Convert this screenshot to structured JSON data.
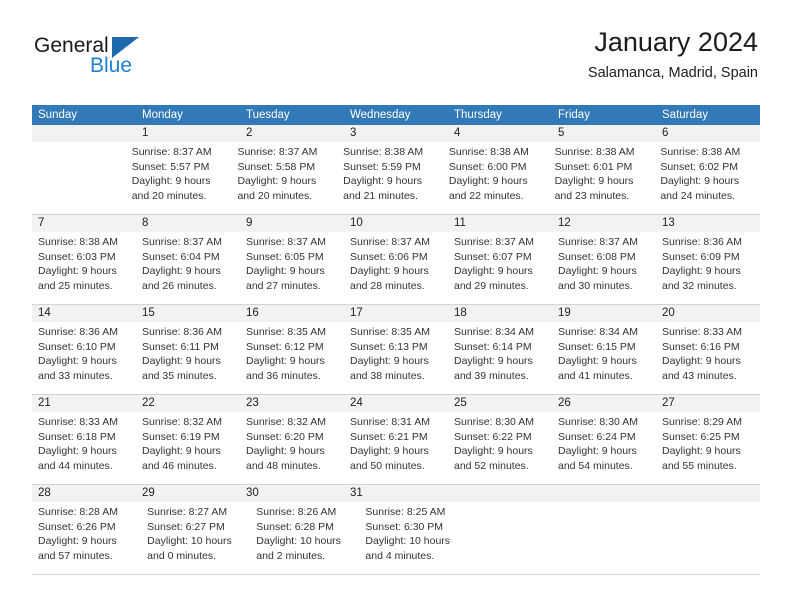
{
  "brand": {
    "name_part1": "General",
    "name_part2": "Blue",
    "logo_icon": "triangle-icon",
    "accent_color": "#1f7fd0",
    "triangle_color": "#1e68ad"
  },
  "header": {
    "month_title": "January 2024",
    "location": "Salamanca, Madrid, Spain",
    "header_bg_color": "#3279b7",
    "datebar_bg_color": "#f2f2f2"
  },
  "weekdays": [
    "Sunday",
    "Monday",
    "Tuesday",
    "Wednesday",
    "Thursday",
    "Friday",
    "Saturday"
  ],
  "weeks": [
    {
      "days": [
        {
          "num": "",
          "empty": true
        },
        {
          "num": "1",
          "sunrise": "Sunrise: 8:37 AM",
          "sunset": "Sunset: 5:57 PM",
          "daylight": "Daylight: 9 hours and 20 minutes."
        },
        {
          "num": "2",
          "sunrise": "Sunrise: 8:37 AM",
          "sunset": "Sunset: 5:58 PM",
          "daylight": "Daylight: 9 hours and 20 minutes."
        },
        {
          "num": "3",
          "sunrise": "Sunrise: 8:38 AM",
          "sunset": "Sunset: 5:59 PM",
          "daylight": "Daylight: 9 hours and 21 minutes."
        },
        {
          "num": "4",
          "sunrise": "Sunrise: 8:38 AM",
          "sunset": "Sunset: 6:00 PM",
          "daylight": "Daylight: 9 hours and 22 minutes."
        },
        {
          "num": "5",
          "sunrise": "Sunrise: 8:38 AM",
          "sunset": "Sunset: 6:01 PM",
          "daylight": "Daylight: 9 hours and 23 minutes."
        },
        {
          "num": "6",
          "sunrise": "Sunrise: 8:38 AM",
          "sunset": "Sunset: 6:02 PM",
          "daylight": "Daylight: 9 hours and 24 minutes."
        }
      ]
    },
    {
      "days": [
        {
          "num": "7",
          "sunrise": "Sunrise: 8:38 AM",
          "sunset": "Sunset: 6:03 PM",
          "daylight": "Daylight: 9 hours and 25 minutes."
        },
        {
          "num": "8",
          "sunrise": "Sunrise: 8:37 AM",
          "sunset": "Sunset: 6:04 PM",
          "daylight": "Daylight: 9 hours and 26 minutes."
        },
        {
          "num": "9",
          "sunrise": "Sunrise: 8:37 AM",
          "sunset": "Sunset: 6:05 PM",
          "daylight": "Daylight: 9 hours and 27 minutes."
        },
        {
          "num": "10",
          "sunrise": "Sunrise: 8:37 AM",
          "sunset": "Sunset: 6:06 PM",
          "daylight": "Daylight: 9 hours and 28 minutes."
        },
        {
          "num": "11",
          "sunrise": "Sunrise: 8:37 AM",
          "sunset": "Sunset: 6:07 PM",
          "daylight": "Daylight: 9 hours and 29 minutes."
        },
        {
          "num": "12",
          "sunrise": "Sunrise: 8:37 AM",
          "sunset": "Sunset: 6:08 PM",
          "daylight": "Daylight: 9 hours and 30 minutes."
        },
        {
          "num": "13",
          "sunrise": "Sunrise: 8:36 AM",
          "sunset": "Sunset: 6:09 PM",
          "daylight": "Daylight: 9 hours and 32 minutes."
        }
      ]
    },
    {
      "days": [
        {
          "num": "14",
          "sunrise": "Sunrise: 8:36 AM",
          "sunset": "Sunset: 6:10 PM",
          "daylight": "Daylight: 9 hours and 33 minutes."
        },
        {
          "num": "15",
          "sunrise": "Sunrise: 8:36 AM",
          "sunset": "Sunset: 6:11 PM",
          "daylight": "Daylight: 9 hours and 35 minutes."
        },
        {
          "num": "16",
          "sunrise": "Sunrise: 8:35 AM",
          "sunset": "Sunset: 6:12 PM",
          "daylight": "Daylight: 9 hours and 36 minutes."
        },
        {
          "num": "17",
          "sunrise": "Sunrise: 8:35 AM",
          "sunset": "Sunset: 6:13 PM",
          "daylight": "Daylight: 9 hours and 38 minutes."
        },
        {
          "num": "18",
          "sunrise": "Sunrise: 8:34 AM",
          "sunset": "Sunset: 6:14 PM",
          "daylight": "Daylight: 9 hours and 39 minutes."
        },
        {
          "num": "19",
          "sunrise": "Sunrise: 8:34 AM",
          "sunset": "Sunset: 6:15 PM",
          "daylight": "Daylight: 9 hours and 41 minutes."
        },
        {
          "num": "20",
          "sunrise": "Sunrise: 8:33 AM",
          "sunset": "Sunset: 6:16 PM",
          "daylight": "Daylight: 9 hours and 43 minutes."
        }
      ]
    },
    {
      "days": [
        {
          "num": "21",
          "sunrise": "Sunrise: 8:33 AM",
          "sunset": "Sunset: 6:18 PM",
          "daylight": "Daylight: 9 hours and 44 minutes."
        },
        {
          "num": "22",
          "sunrise": "Sunrise: 8:32 AM",
          "sunset": "Sunset: 6:19 PM",
          "daylight": "Daylight: 9 hours and 46 minutes."
        },
        {
          "num": "23",
          "sunrise": "Sunrise: 8:32 AM",
          "sunset": "Sunset: 6:20 PM",
          "daylight": "Daylight: 9 hours and 48 minutes."
        },
        {
          "num": "24",
          "sunrise": "Sunrise: 8:31 AM",
          "sunset": "Sunset: 6:21 PM",
          "daylight": "Daylight: 9 hours and 50 minutes."
        },
        {
          "num": "25",
          "sunrise": "Sunrise: 8:30 AM",
          "sunset": "Sunset: 6:22 PM",
          "daylight": "Daylight: 9 hours and 52 minutes."
        },
        {
          "num": "26",
          "sunrise": "Sunrise: 8:30 AM",
          "sunset": "Sunset: 6:24 PM",
          "daylight": "Daylight: 9 hours and 54 minutes."
        },
        {
          "num": "27",
          "sunrise": "Sunrise: 8:29 AM",
          "sunset": "Sunset: 6:25 PM",
          "daylight": "Daylight: 9 hours and 55 minutes."
        }
      ]
    },
    {
      "days": [
        {
          "num": "28",
          "sunrise": "Sunrise: 8:28 AM",
          "sunset": "Sunset: 6:26 PM",
          "daylight": "Daylight: 9 hours and 57 minutes."
        },
        {
          "num": "29",
          "sunrise": "Sunrise: 8:27 AM",
          "sunset": "Sunset: 6:27 PM",
          "daylight": "Daylight: 10 hours and 0 minutes."
        },
        {
          "num": "30",
          "sunrise": "Sunrise: 8:26 AM",
          "sunset": "Sunset: 6:28 PM",
          "daylight": "Daylight: 10 hours and 2 minutes."
        },
        {
          "num": "31",
          "sunrise": "Sunrise: 8:25 AM",
          "sunset": "Sunset: 6:30 PM",
          "daylight": "Daylight: 10 hours and 4 minutes."
        },
        {
          "num": "",
          "empty": true
        },
        {
          "num": "",
          "empty": true
        },
        {
          "num": "",
          "empty": true
        }
      ]
    }
  ]
}
